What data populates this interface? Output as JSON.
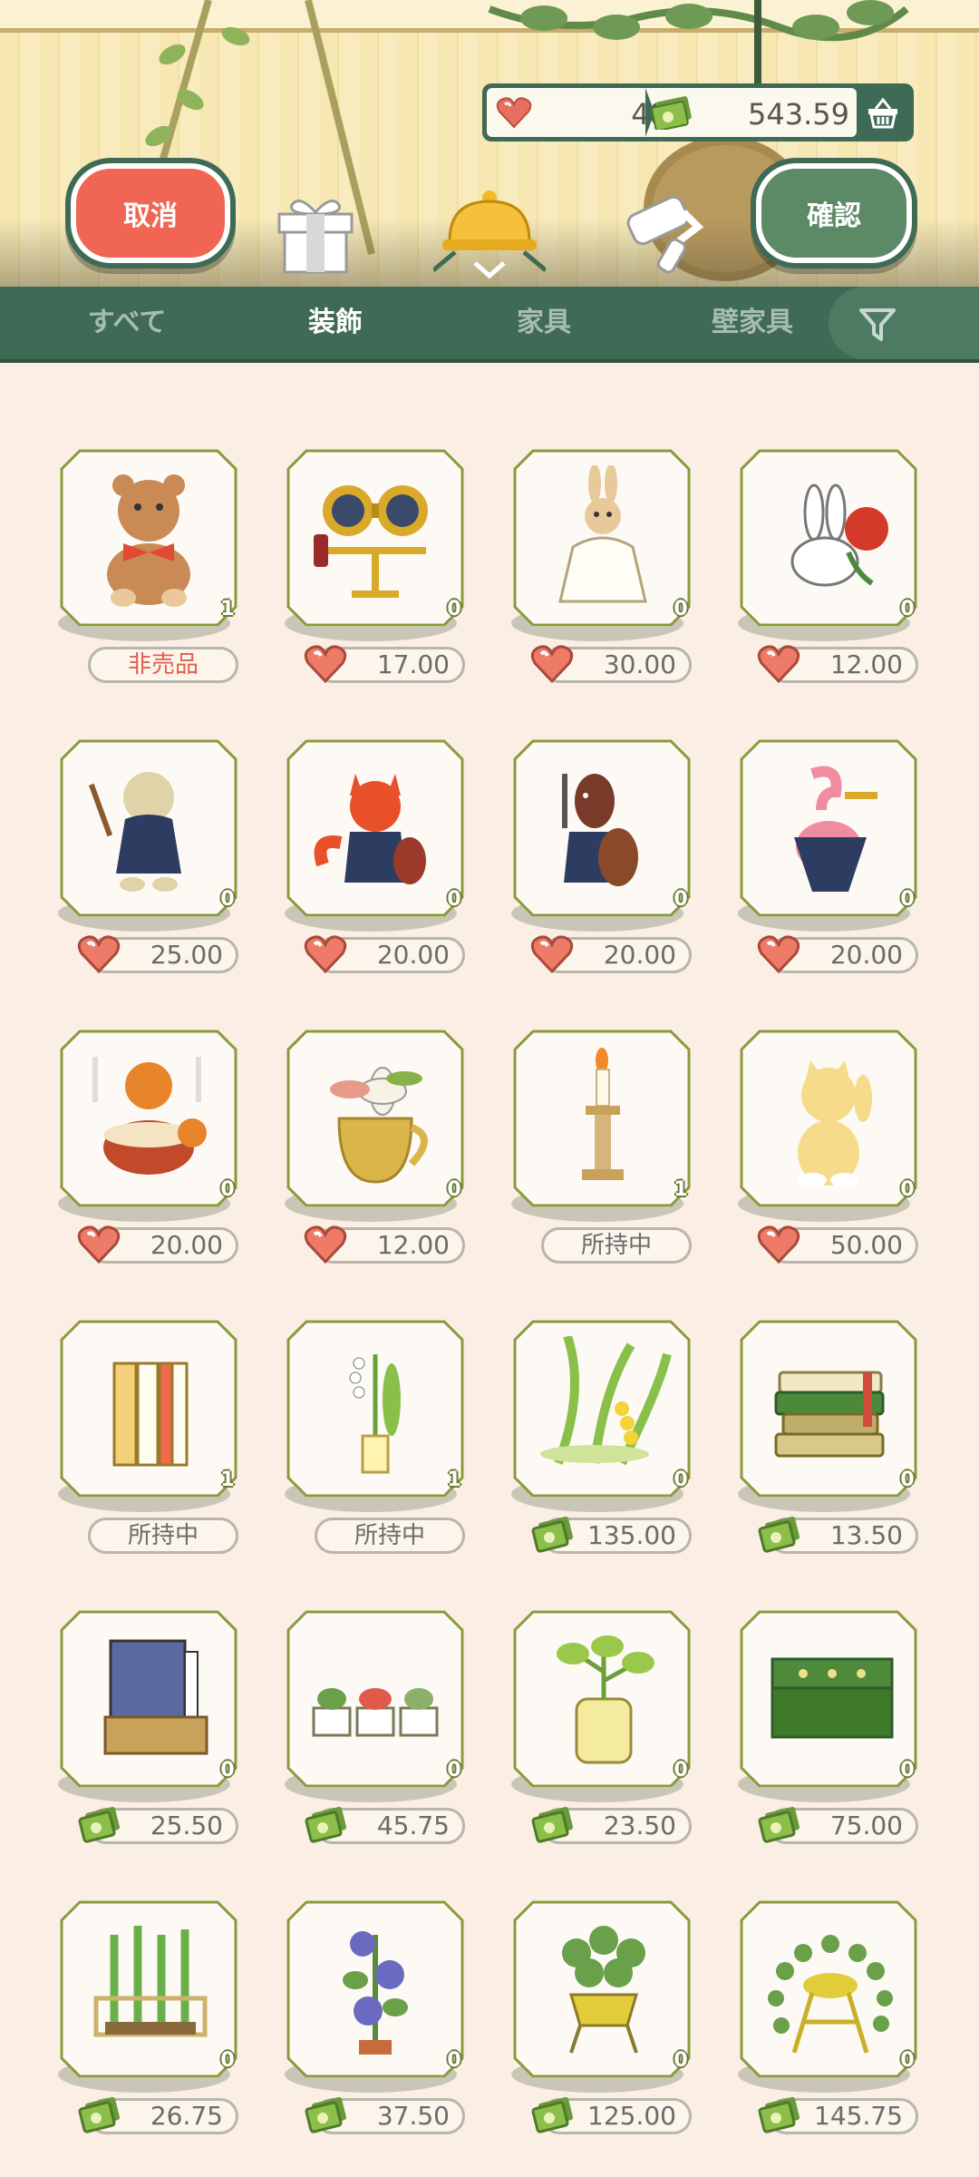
{
  "header": {
    "hearts": "48",
    "money": "543.59",
    "cancel_label": "取消",
    "confirm_label": "確認"
  },
  "tabs": [
    {
      "label": "すべて",
      "active": false
    },
    {
      "label": "装飾",
      "active": true
    },
    {
      "label": "家具",
      "active": false
    },
    {
      "label": "壁家具",
      "active": false
    }
  ],
  "items": [
    {
      "name": "teddy-bear",
      "count": "1",
      "currency": "none",
      "price": "非売品"
    },
    {
      "name": "binoculars-stand",
      "count": "0",
      "currency": "heart",
      "price": "17.00"
    },
    {
      "name": "rabbit-doll",
      "count": "0",
      "currency": "heart",
      "price": "30.00"
    },
    {
      "name": "rabbit-mask-rose",
      "count": "0",
      "currency": "heart",
      "price": "12.00"
    },
    {
      "name": "dog-conductor",
      "count": "0",
      "currency": "heart",
      "price": "25.00"
    },
    {
      "name": "fox-violinist",
      "count": "0",
      "currency": "heart",
      "price": "20.00"
    },
    {
      "name": "horse-cellist",
      "count": "0",
      "currency": "heart",
      "price": "20.00"
    },
    {
      "name": "flamingo-trumpeter",
      "count": "0",
      "currency": "heart",
      "price": "20.00"
    },
    {
      "name": "red-panda-drummer",
      "count": "0",
      "currency": "heart",
      "price": "20.00"
    },
    {
      "name": "flower-pitcher",
      "count": "0",
      "currency": "heart",
      "price": "12.00"
    },
    {
      "name": "candle-stand",
      "count": "1",
      "currency": "none",
      "price": "所持中"
    },
    {
      "name": "waving-cat",
      "count": "0",
      "currency": "heart",
      "price": "50.00"
    },
    {
      "name": "book-set",
      "count": "1",
      "currency": "none",
      "price": "所持中"
    },
    {
      "name": "lily-of-valley-bottle",
      "count": "1",
      "currency": "none",
      "price": "所持中"
    },
    {
      "name": "lily-plant",
      "count": "0",
      "currency": "money",
      "price": "135.00"
    },
    {
      "name": "book-stack",
      "count": "0",
      "currency": "money",
      "price": "13.50"
    },
    {
      "name": "night-picture-book",
      "count": "0",
      "currency": "money",
      "price": "25.50"
    },
    {
      "name": "succulent-trio",
      "count": "0",
      "currency": "money",
      "price": "45.75"
    },
    {
      "name": "pothos-jar",
      "count": "0",
      "currency": "money",
      "price": "23.50"
    },
    {
      "name": "green-planter",
      "count": "0",
      "currency": "money",
      "price": "75.00"
    },
    {
      "name": "bamboo-planter",
      "count": "0",
      "currency": "money",
      "price": "26.75"
    },
    {
      "name": "morning-glory",
      "count": "0",
      "currency": "money",
      "price": "37.50"
    },
    {
      "name": "round-leaf-plant",
      "count": "0",
      "currency": "money",
      "price": "125.00"
    },
    {
      "name": "hanging-plant-stand",
      "count": "0",
      "currency": "money",
      "price": "145.75"
    }
  ],
  "colors": {
    "accent_green": "#3f6a55",
    "cancel_red": "#f06553",
    "confirm_green": "#5c8a66",
    "sale_red": "#e0604e"
  }
}
